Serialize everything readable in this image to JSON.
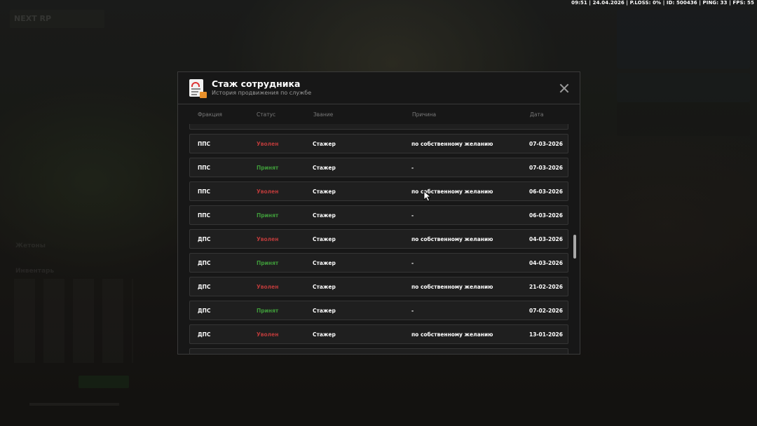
{
  "hud": {
    "stats": "09:51 | 24.04.2026 | P.LOSS: 0% | ID: 500436 | PING: 33 | FPS: 55",
    "logo": "NEXT RP",
    "label_jetons": "Жетоны",
    "label_inventory": "Инвентарь"
  },
  "modal": {
    "title": "Стаж сотрудника",
    "subtitle": "История продвижения по службе",
    "icon": "document-icon",
    "close_icon": "close-icon"
  },
  "table": {
    "headers": {
      "faction": "Фракция",
      "status": "Статус",
      "rank": "Звание",
      "reason": "Причина",
      "date": "Дата"
    },
    "rows": [
      {
        "faction": "",
        "status": "",
        "status_type": "",
        "rank": "",
        "reason": "",
        "date": ""
      },
      {
        "faction": "ППС",
        "status": "Уволен",
        "status_type": "fired",
        "rank": "Стажер",
        "reason": "по собственному желанию",
        "date": "07-03-2026"
      },
      {
        "faction": "ППС",
        "status": "Принят",
        "status_type": "hired",
        "rank": "Стажер",
        "reason": "-",
        "date": "07-03-2026"
      },
      {
        "faction": "ППС",
        "status": "Уволен",
        "status_type": "fired",
        "rank": "Стажер",
        "reason": "по собственному желанию",
        "date": "06-03-2026"
      },
      {
        "faction": "ППС",
        "status": "Принят",
        "status_type": "hired",
        "rank": "Стажер",
        "reason": "-",
        "date": "06-03-2026"
      },
      {
        "faction": "ДПС",
        "status": "Уволен",
        "status_type": "fired",
        "rank": "Стажер",
        "reason": "по собственному желанию",
        "date": "04-03-2026"
      },
      {
        "faction": "ДПС",
        "status": "Принят",
        "status_type": "hired",
        "rank": "Стажер",
        "reason": "-",
        "date": "04-03-2026"
      },
      {
        "faction": "ДПС",
        "status": "Уволен",
        "status_type": "fired",
        "rank": "Стажер",
        "reason": "по собственному желанию",
        "date": "21-02-2026"
      },
      {
        "faction": "ДПС",
        "status": "Принят",
        "status_type": "hired",
        "rank": "Стажер",
        "reason": "-",
        "date": "07-02-2026"
      },
      {
        "faction": "ДПС",
        "status": "Уволен",
        "status_type": "fired",
        "rank": "Стажер",
        "reason": "по собственному желанию",
        "date": "13-01-2026"
      },
      {
        "faction": "",
        "status": "",
        "status_type": "",
        "rank": "",
        "reason": "",
        "date": ""
      }
    ]
  },
  "colors": {
    "fired": "#b83a3a",
    "hired": "#3f9a3a",
    "modal_bg": "#171717",
    "row_bg": "#1f1f1f"
  }
}
